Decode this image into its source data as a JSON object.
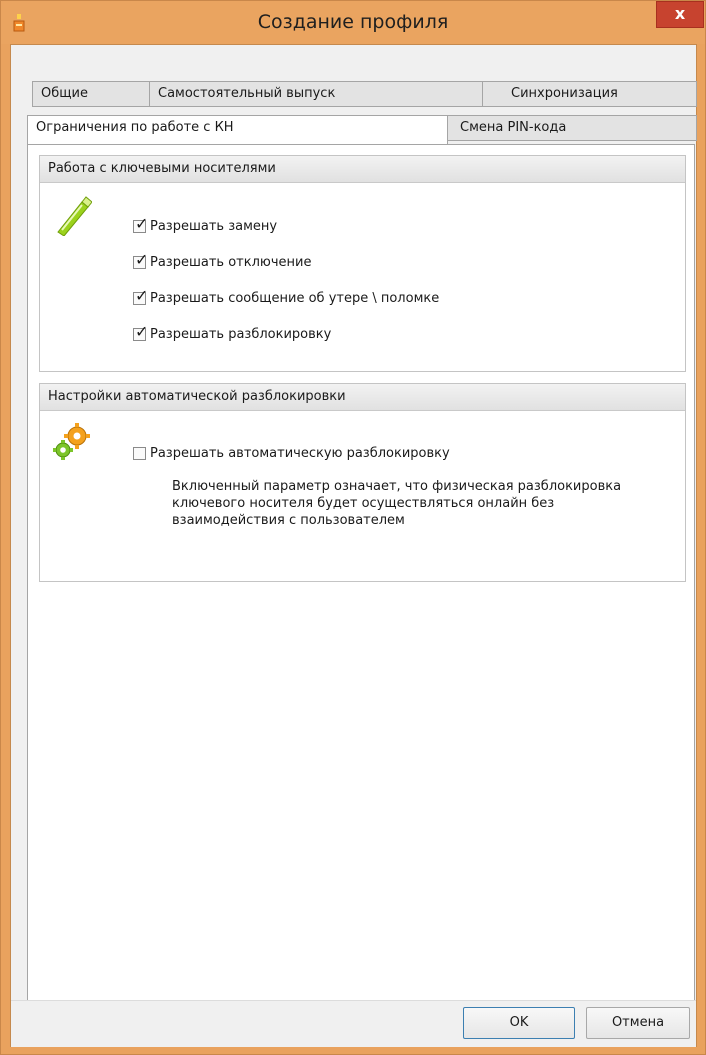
{
  "window": {
    "title": "Создание профиля",
    "close_label": "x"
  },
  "tabs": {
    "row1": [
      {
        "label": "Общие"
      },
      {
        "label": "Самостоятельный выпуск"
      },
      {
        "label": "Синхронизация"
      }
    ],
    "row2": [
      {
        "label": "Ограничения по работе с КН",
        "active": true
      },
      {
        "label": "Смена PIN-кода"
      }
    ]
  },
  "key_media_group": {
    "title": "Работа с ключевыми носителями",
    "icon": "usb-token-icon",
    "options": [
      {
        "label": "Разрешать замену",
        "checked": true
      },
      {
        "label": "Разрешать отключение",
        "checked": true
      },
      {
        "label": "Разрешать сообщение об утере \\ поломке",
        "checked": true
      },
      {
        "label": "Разрешать разблокировку",
        "checked": true
      }
    ]
  },
  "auto_unlock_group": {
    "title": "Настройки автоматической разблокировки",
    "icon": "gears-icon",
    "option": {
      "label": "Разрешать автоматическую разблокировку",
      "checked": false
    },
    "description": "Включенный параметр означает, что физическая разблокировка ключевого носителя будет осуществляться онлайн без взаимодействия с пользователем"
  },
  "footer": {
    "ok_label": "OK",
    "cancel_label": "Отмена"
  },
  "colors": {
    "titlebar": "#eaa460",
    "close_button": "#c7432f",
    "icon_usb": "#9bd21c",
    "icon_gear_green": "#7cc52a",
    "icon_gear_orange": "#f4a11d"
  }
}
